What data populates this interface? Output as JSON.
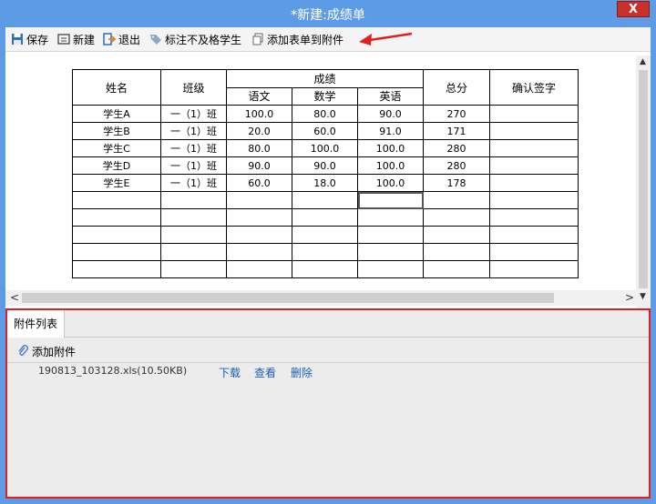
{
  "window": {
    "title": "*新建:成绩单",
    "close_label": "X"
  },
  "toolbar": {
    "save": "保存",
    "new": "新建",
    "exit": "退出",
    "mark_fail": "标注不及格学生",
    "add_to_attach": "添加表单到附件"
  },
  "sheet": {
    "headers": {
      "name": "姓名",
      "class": "班级",
      "score": "成绩",
      "chinese": "语文",
      "math": "数学",
      "english": "英语",
      "total": "总分",
      "sign": "确认签字"
    },
    "rows": [
      {
        "name": "学生A",
        "class": "一（1）班",
        "chinese": "100.0",
        "math": "80.0",
        "english": "90.0",
        "total": "270"
      },
      {
        "name": "学生B",
        "class": "一（1）班",
        "chinese": "20.0",
        "math": "60.0",
        "english": "91.0",
        "total": "171"
      },
      {
        "name": "学生C",
        "class": "一（1）班",
        "chinese": "80.0",
        "math": "100.0",
        "english": "100.0",
        "total": "280"
      },
      {
        "name": "学生D",
        "class": "一（1）班",
        "chinese": "90.0",
        "math": "90.0",
        "english": "100.0",
        "total": "280"
      },
      {
        "name": "学生E",
        "class": "一（1）班",
        "chinese": "60.0",
        "math": "18.0",
        "english": "100.0",
        "total": "178"
      }
    ]
  },
  "scroll": {
    "up": "▲",
    "down": "▼",
    "left": "<",
    "right": ">"
  },
  "attachments": {
    "tab": "附件列表",
    "add": "添加附件",
    "file": {
      "name": "190813_103128.xls(10.50KB)",
      "download": "下载",
      "view": "查看",
      "delete": "删除"
    }
  },
  "colors": {
    "titlebar": "#5d9be6",
    "close": "#c9302a",
    "highlight": "#e02020",
    "link": "#1a5fb4"
  }
}
